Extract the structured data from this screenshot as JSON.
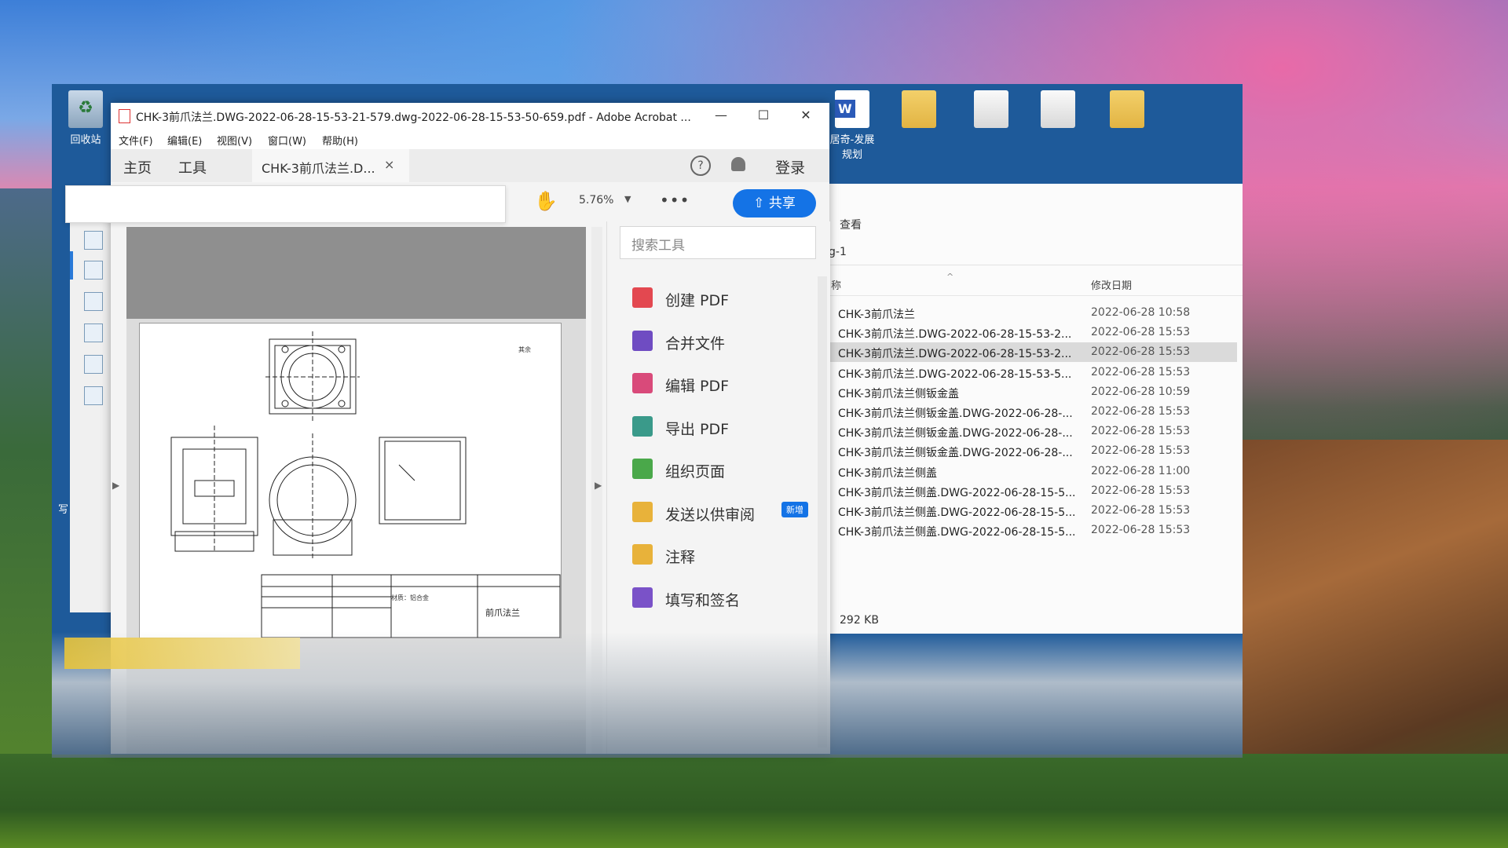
{
  "desktop": {
    "recycle_bin": "回收站",
    "word_doc": "居奇-发展\n规划",
    "side_label": "写"
  },
  "acrobat": {
    "window_title": "CHK-3前爪法兰.DWG-2022-06-28-15-53-21-579.dwg-2022-06-28-15-53-50-659.pdf - Adobe Acrobat ...",
    "minimize": "—",
    "maximize": "☐",
    "close": "✕",
    "menu": [
      "文件(F)",
      "编辑(E)",
      "视图(V)",
      "窗口(W)",
      "帮助(H)"
    ],
    "tabs": {
      "home": "主页",
      "tools": "工具",
      "doc": "CHK-3前爪法兰.D...",
      "doc_close": "×"
    },
    "help": "?",
    "login": "登录",
    "zoom": "5.76%",
    "more": "•••",
    "share": "共享",
    "drawing": {
      "title_cell": "前爪法兰",
      "material": "材质：铝合金",
      "note": "其余"
    },
    "tools_search_placeholder": "搜索工具",
    "tools": [
      {
        "label": "创建 PDF",
        "color": "#e34850"
      },
      {
        "label": "合并文件",
        "color": "#6f4cc2"
      },
      {
        "label": "编辑 PDF",
        "color": "#d94a7a"
      },
      {
        "label": "导出 PDF",
        "color": "#3a9a8a"
      },
      {
        "label": "组织页面",
        "color": "#4aa84a"
      },
      {
        "label": "发送以供审阅",
        "color": "#e8b23a",
        "badge": "新增"
      },
      {
        "label": "注释",
        "color": "#e8b23a"
      },
      {
        "label": "填写和签名",
        "color": "#7a52c8"
      }
    ]
  },
  "explorer": {
    "view": "查看",
    "path": "g-1",
    "col_name": "称",
    "col_date": "修改日期",
    "files": [
      {
        "name": "CHK-3前爪法兰",
        "date": "2022-06-28 10:58"
      },
      {
        "name": "CHK-3前爪法兰.DWG-2022-06-28-15-53-2...",
        "date": "2022-06-28 15:53"
      },
      {
        "name": "CHK-3前爪法兰.DWG-2022-06-28-15-53-2...",
        "date": "2022-06-28 15:53"
      },
      {
        "name": "CHK-3前爪法兰.DWG-2022-06-28-15-53-5...",
        "date": "2022-06-28 15:53"
      },
      {
        "name": "CHK-3前爪法兰侧钣金盖",
        "date": "2022-06-28 10:59"
      },
      {
        "name": "CHK-3前爪法兰侧钣金盖.DWG-2022-06-28-...",
        "date": "2022-06-28 15:53"
      },
      {
        "name": "CHK-3前爪法兰侧钣金盖.DWG-2022-06-28-...",
        "date": "2022-06-28 15:53"
      },
      {
        "name": "CHK-3前爪法兰侧钣金盖.DWG-2022-06-28-...",
        "date": "2022-06-28 15:53"
      },
      {
        "name": "CHK-3前爪法兰侧盖",
        "date": "2022-06-28 11:00"
      },
      {
        "name": "CHK-3前爪法兰侧盖.DWG-2022-06-28-15-5...",
        "date": "2022-06-28 15:53"
      },
      {
        "name": "CHK-3前爪法兰侧盖.DWG-2022-06-28-15-5...",
        "date": "2022-06-28 15:53"
      },
      {
        "name": "CHK-3前爪法兰侧盖.DWG-2022-06-28-15-5...",
        "date": "2022-06-28 15:53"
      }
    ],
    "selected_index": 2,
    "size": "292 KB"
  }
}
